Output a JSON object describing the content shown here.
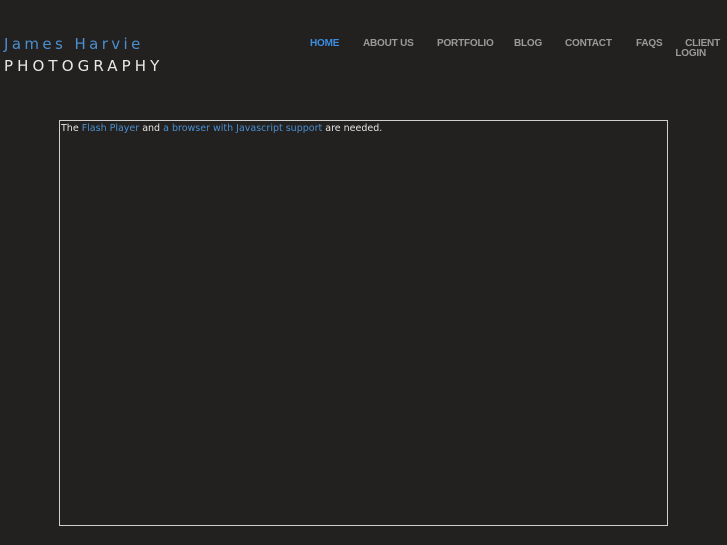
{
  "brand": {
    "name": "James Harvie",
    "subtitle": "PHOTOGRAPHY"
  },
  "nav": {
    "home": "HOME",
    "about": "ABOUT US",
    "portfolio": "PORTFOLIO",
    "blog": "BLOG",
    "contact": "CONTACT",
    "faqs": "FAQS",
    "client_line1": "CLIENT",
    "client_line2": "LOGIN",
    "active_color": "#3b8ee0",
    "color": "#9a9a9a"
  },
  "notice": {
    "prefix": "The",
    "flash_link": "Flash Player",
    "middle": "and",
    "browser_link": "a browser with Javascript support",
    "suffix": "are needed."
  },
  "colors": {
    "background": "#232120",
    "accent": "#4a8fd0",
    "box_border": "#cfcfcf"
  }
}
